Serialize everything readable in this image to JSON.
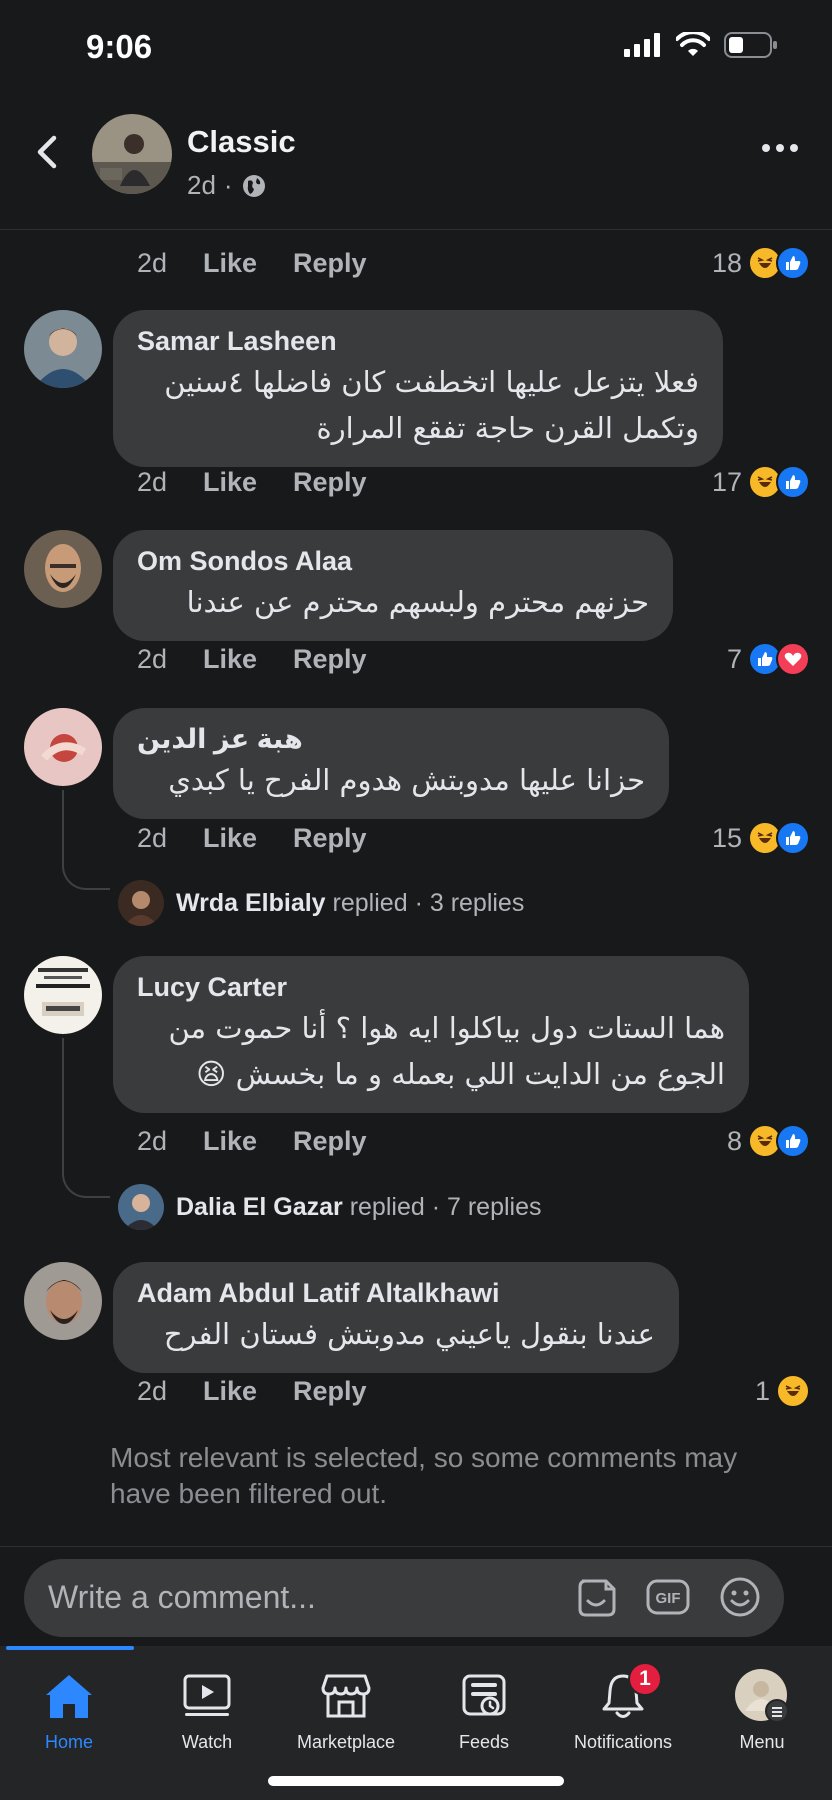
{
  "status_bar": {
    "time": "9:06"
  },
  "header": {
    "name": "Classic",
    "time": "2d",
    "separator": "·"
  },
  "top_row": {
    "time": "2d",
    "like": "Like",
    "reply": "Reply",
    "count": "18"
  },
  "comments": [
    {
      "author": "Samar Lasheen",
      "lines": [
        "فعلا يتزعل عليها اتخطفت كان فاضلها ٤سنين",
        "وتكمل القرن حاجة تفقع المرارة"
      ],
      "time": "2d",
      "like": "Like",
      "reply": "Reply",
      "count": "17"
    },
    {
      "author": "Om Sondos Alaa",
      "lines": [
        "حزنهم محترم  ولبسهم  محترم  عن عندنا"
      ],
      "time": "2d",
      "like": "Like",
      "reply": "Reply",
      "count": "7"
    },
    {
      "author": "هبة عز الدين",
      "lines": [
        "حزانا عليها مدوبتش هدوم الفرح يا كبدي"
      ],
      "time": "2d",
      "like": "Like",
      "reply": "Reply",
      "count": "15",
      "replies": {
        "name": "Wrda Elbialy",
        "action": "replied",
        "sep": "·",
        "count": "3 replies"
      }
    },
    {
      "author": "Lucy Carter",
      "lines": [
        "هما الستات دول بياكلوا ايه هوا ؟ أنا حموت من",
        "الجوع من الدايت اللي بعمله و ما بخسش 😫"
      ],
      "time": "2d",
      "like": "Like",
      "reply": "Reply",
      "count": "8",
      "replies": {
        "name": "Dalia El Gazar",
        "action": "replied",
        "sep": "·",
        "count": "7 replies"
      }
    },
    {
      "author": "Adam Abdul Latif Altalkhawi",
      "lines": [
        "عندنا بنقول ياعيني  مدوبتش فستان الفرح"
      ],
      "time": "2d",
      "like": "Like",
      "reply": "Reply",
      "count": "1"
    }
  ],
  "filter_note": "Most relevant is selected, so some comments may have been filtered out.",
  "composer": {
    "placeholder": "Write a comment...",
    "gif": "GIF"
  },
  "nav": {
    "items": [
      {
        "label": "Home"
      },
      {
        "label": "Watch"
      },
      {
        "label": "Marketplace"
      },
      {
        "label": "Feeds"
      },
      {
        "label": "Notifications",
        "badge": "1"
      },
      {
        "label": "Menu"
      }
    ]
  },
  "colors": {
    "accent": "#2d88ff",
    "background": "#18191a",
    "bubble": "#3a3b3c",
    "badge": "#e41e3f"
  }
}
